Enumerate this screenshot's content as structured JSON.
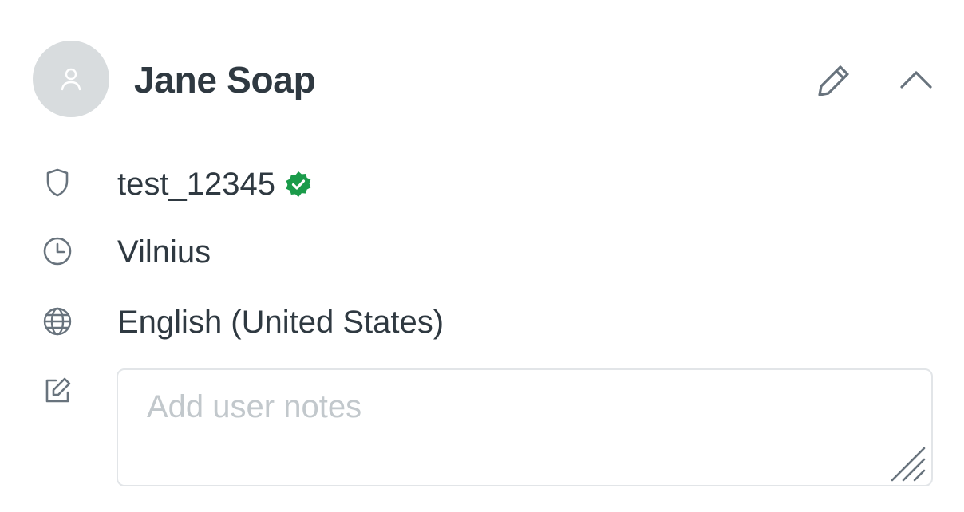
{
  "user": {
    "name": "Jane Soap",
    "avatar_icon": "user-icon"
  },
  "header_actions": {
    "edit_icon": "pencil-icon",
    "collapse_icon": "chevron-up-icon"
  },
  "details": {
    "username": "test_12345",
    "username_icon": "shield-icon",
    "verified_icon": "verified-badge-icon",
    "verified_color": "#1a9b4a",
    "location": "Vilnius",
    "location_icon": "clock-icon",
    "language": "English (United States)",
    "language_icon": "globe-icon"
  },
  "notes": {
    "icon": "note-edit-icon",
    "placeholder": "Add user notes",
    "value": ""
  },
  "colors": {
    "text": "#2f3941",
    "icon": "#68737d",
    "avatar_bg": "#d8dcde",
    "border": "#e2e5e8",
    "placeholder": "#c2c8cc"
  }
}
